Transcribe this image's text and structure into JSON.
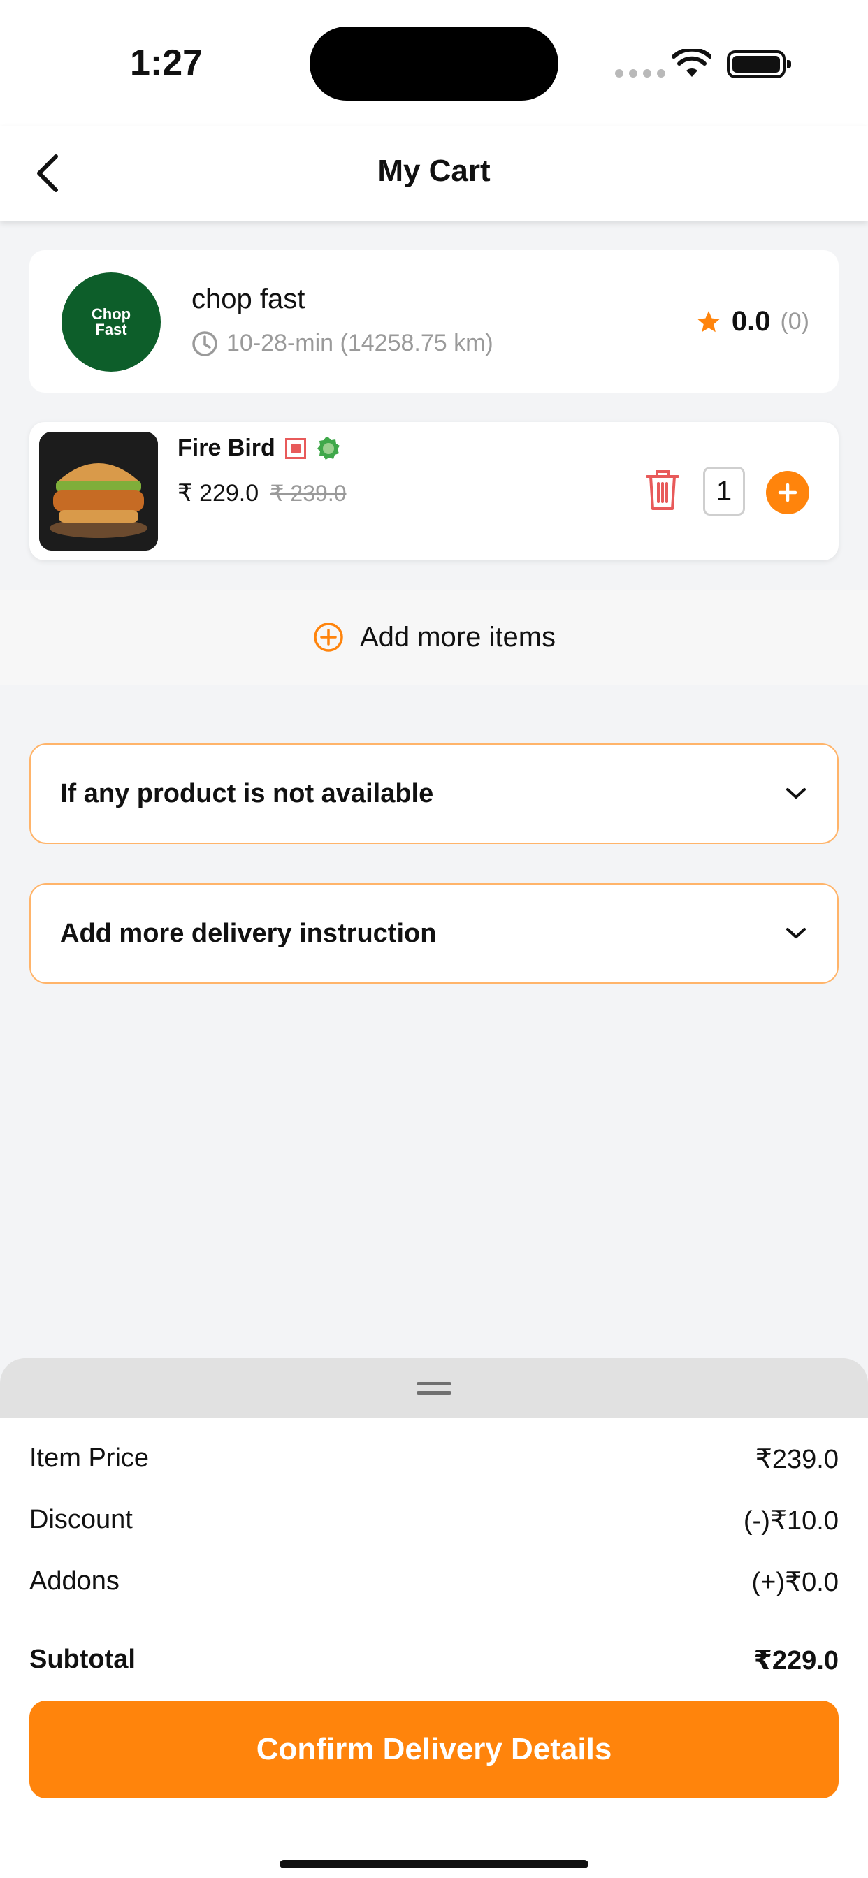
{
  "status_bar": {
    "time": "1:27"
  },
  "header": {
    "title": "My Cart"
  },
  "restaurant": {
    "name": "chop fast",
    "logo_line1": "Chop",
    "logo_line2": "Fast",
    "delivery_info": "10-28-min (14258.75 km)",
    "rating": "0.0",
    "rating_count": "(0)"
  },
  "cart_item": {
    "name": "Fire Bird",
    "price": "₹ 229.0",
    "original_price": "₹ 239.0",
    "quantity": "1"
  },
  "add_more": {
    "label": "Add more items"
  },
  "dropdowns": {
    "unavailable": "If any product is not available",
    "instructions": "Add more delivery instruction"
  },
  "summary": {
    "item_price_label": "Item Price",
    "item_price_value": "₹239.0",
    "discount_label": "Discount",
    "discount_value": "(-)₹10.0",
    "addons_label": "Addons",
    "addons_value": "(+)₹0.0",
    "subtotal_label": "Subtotal",
    "subtotal_value": "₹229.0"
  },
  "confirm_button": {
    "label": "Confirm Delivery Details"
  },
  "colors": {
    "accent": "#ff840c",
    "brand_green": "#0d5e2a",
    "delete_red": "#e85a5a"
  }
}
